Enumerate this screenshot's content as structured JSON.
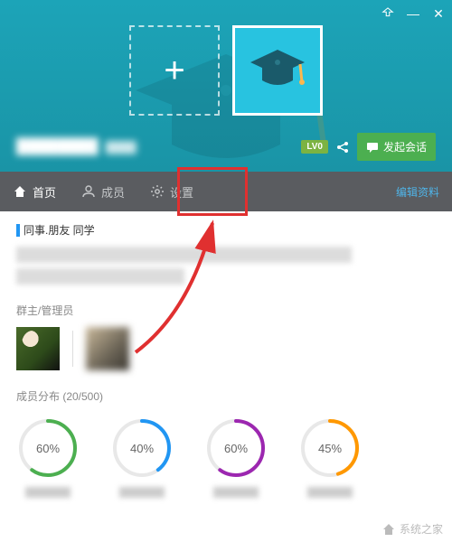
{
  "window": {
    "pin_icon": "pin",
    "minimize": "—",
    "close": "✕"
  },
  "header": {
    "title_blurred": "████████",
    "subtitle_blurred": "████",
    "level_badge": "LV0",
    "share_icon": "share",
    "start_chat": "发起会话"
  },
  "nav": {
    "tabs": [
      {
        "icon": "home",
        "label": "首页",
        "active": true
      },
      {
        "icon": "user",
        "label": "成员",
        "active": false
      },
      {
        "icon": "gear",
        "label": "设置",
        "active": false
      }
    ],
    "edit_link": "编辑资料"
  },
  "content": {
    "tags": "同事.朋友  同学",
    "admins_title": "群主/管理员",
    "distribution_title": "成员分布  (20/500)"
  },
  "chart_data": {
    "type": "pie",
    "title": "成员分布 (20/500)",
    "series": [
      {
        "name": "ring1",
        "values": [
          60
        ],
        "color": "#4caf50"
      },
      {
        "name": "ring2",
        "values": [
          40
        ],
        "color": "#2196f3"
      },
      {
        "name": "ring3",
        "values": [
          60
        ],
        "color": "#9c27b0"
      },
      {
        "name": "ring4",
        "values": [
          45
        ],
        "color": "#ff9800"
      }
    ]
  },
  "watermark": "系统之家"
}
